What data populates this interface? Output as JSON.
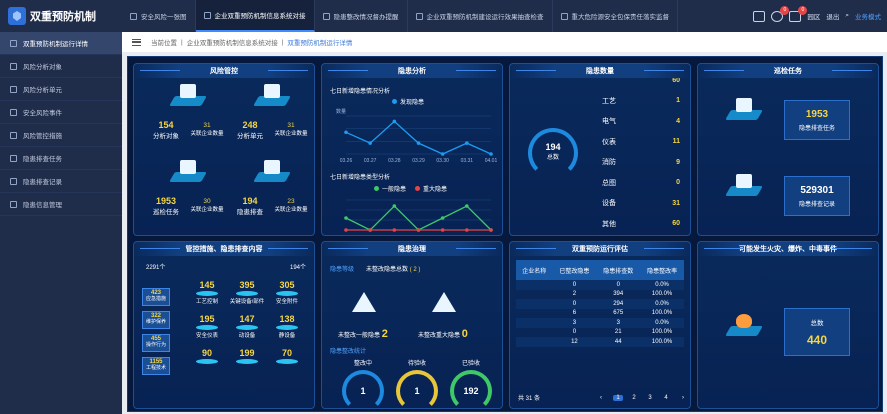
{
  "app": {
    "name": "双重预防机制"
  },
  "tabs": [
    {
      "label": "安全风险一张图",
      "active": false
    },
    {
      "label": "企业双重预防机制信息系统对接",
      "active": true
    },
    {
      "label": "隐患整改情况督办提醒",
      "active": false
    },
    {
      "label": "企业双重预防机制建设运行效果抽查检查",
      "active": false
    },
    {
      "label": "重大危险源安全包保责任落实监督",
      "active": false
    }
  ],
  "top_right": {
    "badge1": "0",
    "badge2": "0",
    "region": "园区",
    "exit": "退出",
    "theme": "业务模式"
  },
  "sidebar": [
    {
      "label": "双重预防机制运行详情",
      "active": true
    },
    {
      "label": "风险分析对象",
      "active": false
    },
    {
      "label": "风险分析单元",
      "active": false
    },
    {
      "label": "安全风险事件",
      "active": false
    },
    {
      "label": "风险管控措施",
      "active": false
    },
    {
      "label": "隐患排查任务",
      "active": false
    },
    {
      "label": "隐患排查记录",
      "active": false
    },
    {
      "label": "隐患信息管理",
      "active": false
    }
  ],
  "breadcrumb": {
    "home": "当前位置",
    "level1": "企业双重预防机制信息系统对接",
    "level2": "双重预防机制运行详情",
    "sep1": "|",
    "sep2": "|"
  },
  "risk": {
    "title": "风险管控",
    "objects": {
      "value": "154",
      "label": "分析对象",
      "sub_value": "31",
      "sub_label": "关联企业数量"
    },
    "units": {
      "value": "248",
      "label": "分析单元",
      "sub_value": "31",
      "sub_label": "关联企业数量"
    },
    "tasks": {
      "value": "1953",
      "label": "巡检任务",
      "sub_value": "30",
      "sub_label": "关联企业数量"
    },
    "checks": {
      "value": "194",
      "label": "隐患排查",
      "sub_value": "23",
      "sub_label": "关联企业数量"
    }
  },
  "hazard_analysis": {
    "title": "隐患分析",
    "chart1_title": "七日新增隐患情况分析",
    "chart1_legend": "发现隐患",
    "chart1_ylabel": "数量",
    "chart2_title": "七日新增隐患类型分析",
    "chart2_legend1": "一般隐患",
    "chart2_legend2": "重大隐患"
  },
  "chart_data": [
    {
      "type": "line",
      "title": "七日新增隐患情况分析",
      "ylabel": "数量",
      "x": [
        "03.26",
        "03.27",
        "03.28",
        "03.29",
        "03.30",
        "03.31",
        "04.01"
      ],
      "series": [
        {
          "name": "发现隐患",
          "values": [
            2,
            1,
            3,
            1,
            0,
            1,
            0
          ]
        }
      ],
      "color": "#1d9bf0"
    },
    {
      "type": "line",
      "title": "七日新增隐患类型分析",
      "x": [
        "03.26",
        "03.27",
        "03.28",
        "03.29",
        "03.30",
        "03.31",
        "04.01"
      ],
      "series": [
        {
          "name": "一般隐患",
          "values": [
            1,
            0,
            2,
            0,
            1,
            2,
            0
          ],
          "color": "#3ec868"
        },
        {
          "name": "重大隐患",
          "values": [
            0,
            0,
            0,
            0,
            0,
            0,
            0
          ],
          "color": "#e64545"
        }
      ]
    }
  ],
  "hazard_count": {
    "title": "隐患数量",
    "total_value": "194",
    "total_label": "总数",
    "items": [
      {
        "label": "",
        "value": "60"
      },
      {
        "label": "工艺",
        "value": "1"
      },
      {
        "label": "电气",
        "value": "4"
      },
      {
        "label": "仪表",
        "value": "11"
      },
      {
        "label": "消防",
        "value": "9"
      },
      {
        "label": "总图",
        "value": "0"
      },
      {
        "label": "设备",
        "value": "31"
      },
      {
        "label": "其他",
        "value": "60"
      }
    ]
  },
  "inspect": {
    "title": "巡检任务",
    "task_value": "1953",
    "task_label": "隐患排查任务",
    "record_value": "529301",
    "record_label": "隐患排查记录"
  },
  "measures": {
    "title": "管控措施、隐患排查内容",
    "left_count": "2291个",
    "right_count": "194个",
    "boxes": [
      {
        "value": "423",
        "label": "应急措施"
      },
      {
        "value": "322",
        "label": "维护保养"
      },
      {
        "value": "455",
        "label": "操作行为"
      },
      {
        "value": "1155",
        "label": "工程技术"
      }
    ],
    "grid": [
      {
        "value": "145",
        "label": "工艺控制"
      },
      {
        "value": "395",
        "label": "关键设备/部件"
      },
      {
        "value": "305",
        "label": "安全附件"
      },
      {
        "value": "195",
        "label": "安全仪表"
      },
      {
        "value": "147",
        "label": "动设备"
      },
      {
        "value": "138",
        "label": "静设备"
      },
      {
        "value": "90",
        "label": ""
      },
      {
        "value": "199",
        "label": ""
      },
      {
        "value": "70",
        "label": ""
      }
    ]
  },
  "governance": {
    "title": "隐患治理",
    "tab1": "隐患等级",
    "tab2_label": "未整改隐患总数",
    "tab2_value": "( 2 )",
    "general_label": "未整改一般隐患",
    "general_value": "2",
    "major_label": "未整改重大隐患",
    "major_value": "0",
    "stats_title": "隐患整改统计",
    "rings": [
      {
        "label": "整改中",
        "value": "1"
      },
      {
        "label": "待验收",
        "value": "1"
      },
      {
        "label": "已验收",
        "value": "192"
      }
    ]
  },
  "evaluation": {
    "title": "双重预防运行评估",
    "headers": [
      "企业名称",
      "已整改隐患",
      "隐患排查数",
      "隐患整改率"
    ],
    "rows": [
      [
        "",
        "0",
        "0",
        "0.0%"
      ],
      [
        "",
        "2",
        "394",
        "100.0%"
      ],
      [
        "",
        "0",
        "294",
        "0.0%"
      ],
      [
        "",
        "6",
        "675",
        "100.0%"
      ],
      [
        "",
        "3",
        "3",
        "0.0%"
      ],
      [
        "",
        "0",
        "21",
        "100.0%"
      ],
      [
        "",
        "12",
        "44",
        "100.0%"
      ]
    ],
    "total": "共 31 条",
    "pages": [
      "1",
      "2",
      "3",
      "4"
    ]
  },
  "accidents": {
    "title": "可能发生火灾、爆炸、中毒事件",
    "total_label": "总数",
    "total_value": "440"
  }
}
